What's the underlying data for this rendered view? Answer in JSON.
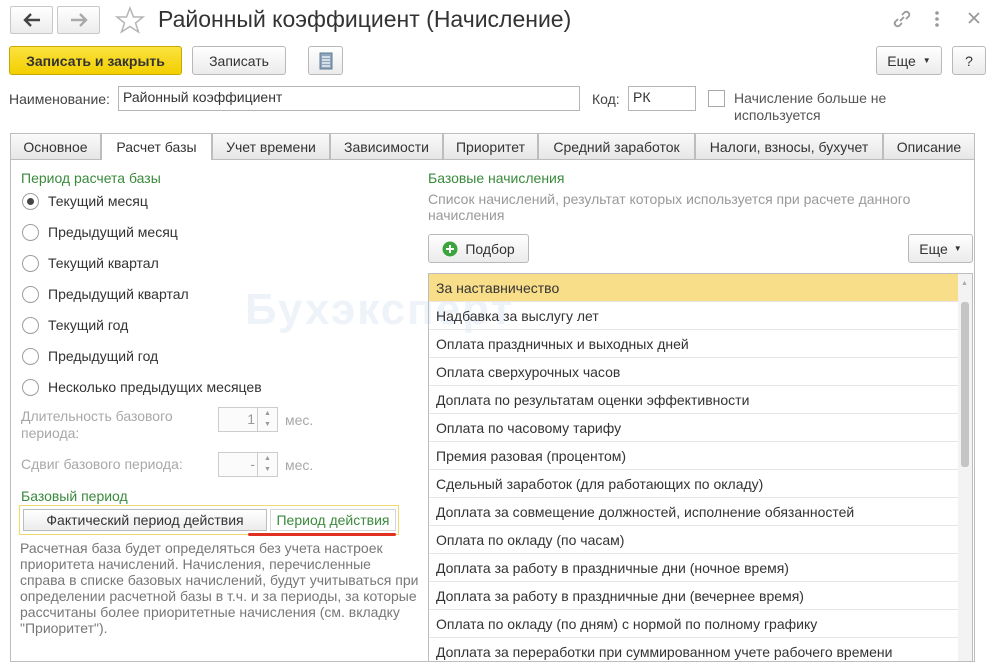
{
  "window": {
    "title": "Районный коэффициент (Начисление)"
  },
  "toolbar": {
    "save_close": "Записать и закрыть",
    "save": "Записать",
    "more": "Еще",
    "help": "?"
  },
  "form": {
    "name_label": "Наименование:",
    "name_value": "Районный коэффициент",
    "code_label": "Код:",
    "code_value": "РК",
    "unused_label_1": "Начисление больше не",
    "unused_label_2": "используется"
  },
  "tabs": [
    "Основное",
    "Расчет базы",
    "Учет времени",
    "Зависимости",
    "Приоритет",
    "Средний заработок",
    "Налоги, взносы, бухучет",
    "Описание"
  ],
  "base_period": {
    "heading": "Период расчета базы",
    "options": [
      "Текущий месяц",
      "Предыдущий месяц",
      "Текущий квартал",
      "Предыдущий квартал",
      "Текущий год",
      "Предыдущий год",
      "Несколько предыдущих месяцев"
    ],
    "selected_index": 0,
    "duration_label_1": "Длительность базового",
    "duration_label_2": "периода:",
    "duration_value": "1",
    "duration_unit": "мес.",
    "shift_label": "Сдвиг базового периода:",
    "shift_value": "-",
    "shift_unit": "мес."
  },
  "base_kind": {
    "heading": "Базовый период",
    "option_actual": "Фактический период действия",
    "option_period": "Период действия",
    "selected": "option_period",
    "description": "Расчетная база будет определяться без учета настроек приоритета начислений. Начисления, перечисленные справа в списке базовых начислений, будут учитываться при определении расчетной базы в т.ч. и за периоды, за которые рассчитаны более приоритетные начисления (см. вкладку \"Приоритет\")."
  },
  "base_accruals": {
    "heading": "Базовые начисления",
    "subtitle": "Список начислений, результат которых используется при расчете данного начисления",
    "pick_button": "Подбор",
    "more_button": "Еще",
    "items": [
      "За наставничество",
      "Надбавка за выслугу лет",
      "Оплата праздничных и выходных дней",
      "Оплата сверхурочных часов",
      "Доплата по результатам оценки эффективности",
      "Оплата по часовому тарифу",
      "Премия разовая (процентом)",
      "Сдельный заработок (для работающих по окладу)",
      "Доплата за совмещение должностей, исполнение обязанностей",
      "Оплата по окладу (по часам)",
      "Доплата за работу в праздничные дни (ночное время)",
      "Доплата за работу в праздничные дни (вечернее время)",
      "Оплата по окладу (по дням) с нормой по полному графику",
      "Доплата за переработки при суммированном учете рабочего времени"
    ],
    "selected_index": 0
  },
  "watermark": "Бухэксперт",
  "colors": {
    "accent_yellow": "#f3cf00",
    "selection": "#f9de8a",
    "green_text": "#3a8a3c",
    "red_underline": "#e03020"
  }
}
